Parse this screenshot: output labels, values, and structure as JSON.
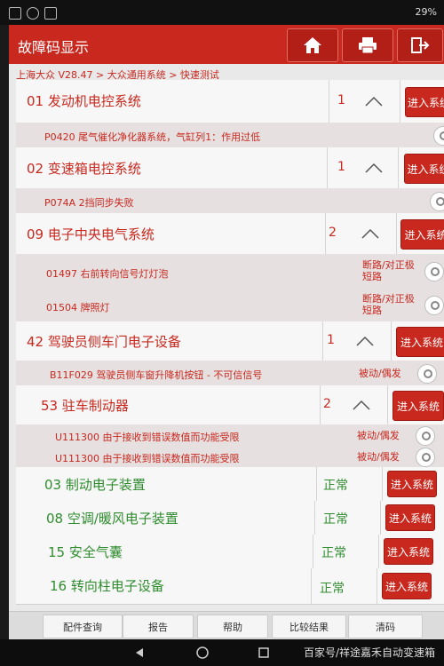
{
  "status": {
    "right": "29%"
  },
  "header": {
    "title": "故障码显示"
  },
  "breadcrumb": "上海大众 V28.47 > 大众通用系统 > 快速测试",
  "enter_label": "进入系统",
  "systems": [
    {
      "name": "01 发动机电控系统",
      "count": "1"
    },
    {
      "name": "02 变速箱电控系统",
      "count": "1"
    },
    {
      "name": "09 电子中央电气系统",
      "count": "2"
    },
    {
      "name": "42 驾驶员侧车门电子设备",
      "count": "1"
    },
    {
      "name": "53 驻车制动器",
      "count": "2"
    }
  ],
  "faults": [
    {
      "text": "P0420 尾气催化净化器系统，气缸列1：作用过低",
      "status": ""
    },
    {
      "text": "P074A 2挡同步失败",
      "status": ""
    },
    {
      "text": "01497 右前转向信号灯灯泡",
      "status": "断路/对正极短路"
    },
    {
      "text": "01504 牌照灯",
      "status": "断路/对正极短路"
    },
    {
      "text": "B11F029 驾驶员侧车窗升降机按钮 - 不可信信号",
      "status": "被动/偶发"
    },
    {
      "text": "U111300 由于接收到错误数值而功能受限",
      "status": "被动/偶发"
    },
    {
      "text": "U111300 由于接收到错误数值而功能受限",
      "status": "被动/偶发"
    }
  ],
  "ok_systems": [
    {
      "name": "03 制动电子装置",
      "status": "正常"
    },
    {
      "name": "08 空调/暖风电子装置",
      "status": "正常"
    },
    {
      "name": "15 安全气囊",
      "status": "正常"
    },
    {
      "name": "16 转向柱电子设备",
      "status": "正常"
    }
  ],
  "bottom_buttons": [
    "配件查询",
    "报告",
    "帮助",
    "比较结果",
    "清码"
  ],
  "nav": {
    "caption": "百家号/祥途嘉禾自动变速箱"
  }
}
